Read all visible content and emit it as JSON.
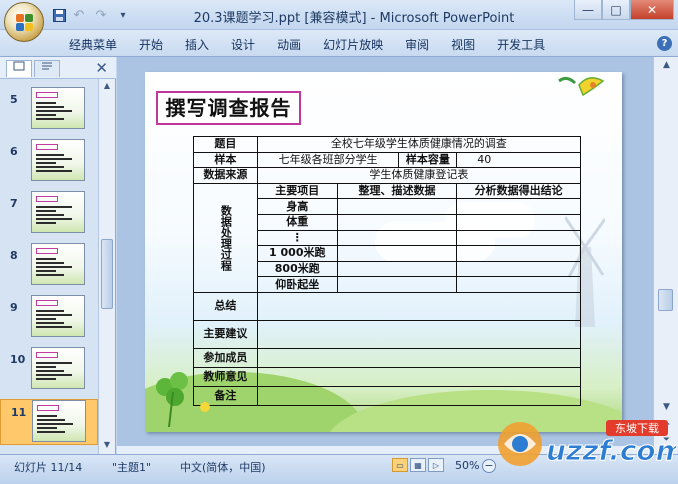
{
  "window": {
    "title": "20.3课题学习.ppt [兼容模式] - Microsoft PowerPoint",
    "controls": {
      "minimize": "—",
      "maximize": "□",
      "close": "✕"
    }
  },
  "qat": {
    "save": "💾",
    "undo": "↶",
    "redo": "↷",
    "customize": "▾"
  },
  "ribbon": {
    "tabs": [
      "经典菜单",
      "开始",
      "插入",
      "设计",
      "动画",
      "幻灯片放映",
      "审阅",
      "视图",
      "开发工具"
    ],
    "help": "?"
  },
  "leftpane": {
    "close": "✕",
    "slides": [
      {
        "num": "5"
      },
      {
        "num": "6"
      },
      {
        "num": "7"
      },
      {
        "num": "8"
      },
      {
        "num": "9"
      },
      {
        "num": "10"
      },
      {
        "num": "11"
      }
    ],
    "selected_index": 6
  },
  "slide": {
    "title": "撰写调查报告",
    "table": {
      "topic_label": "题目",
      "topic_value": "全校七年级学生体质健康情况的调查",
      "sample_label": "样本",
      "sample_value": "七年级各班部分学生",
      "capacity_label": "样本容量",
      "capacity_value": "40",
      "source_label": "数据来源",
      "source_value": "学生体质健康登记表",
      "process_label": "数据处理过程",
      "col_headers": [
        "主要项目",
        "整理、描述数据",
        "分析数据得出结论"
      ],
      "items": [
        "身高",
        "体重",
        "⋮",
        "1 000米跑",
        "800米跑",
        "仰卧起坐"
      ],
      "summary_label": "总结",
      "suggestion_label": "主要建议",
      "members_label": "参加成员",
      "teacher_label": "教师意见",
      "remark_label": "备注"
    }
  },
  "status": {
    "slide_info": "幻灯片 11/14",
    "theme": "\"主题1\"",
    "language": "中文(简体，中国)",
    "zoom": "50%",
    "zoom_out": "−",
    "zoom_in": "+"
  },
  "watermark": {
    "text": "uzzf.com",
    "badge": "东坡下载"
  },
  "colors": {
    "title_border": "#c0389e",
    "selected_thumb": "#ffc96b",
    "ribbon_text": "#15325e"
  }
}
